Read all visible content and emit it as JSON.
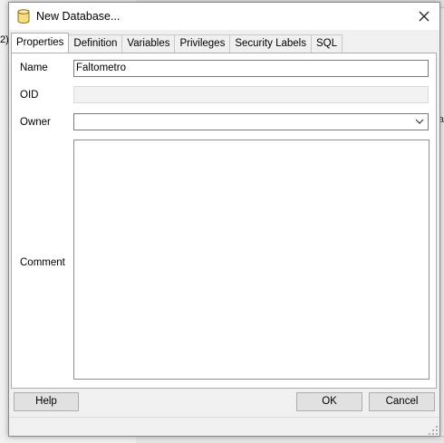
{
  "background": {
    "left_text": "2)",
    "right_text": "ra"
  },
  "dialog": {
    "title": "New Database...",
    "tabs": [
      {
        "label": "Properties",
        "active": true
      },
      {
        "label": "Definition"
      },
      {
        "label": "Variables"
      },
      {
        "label": "Privileges"
      },
      {
        "label": "Security Labels"
      },
      {
        "label": "SQL"
      }
    ],
    "form": {
      "name_label": "Name",
      "name_value": "Faltometro",
      "oid_label": "OID",
      "oid_value": "",
      "owner_label": "Owner",
      "owner_value": "",
      "comment_label": "Comment",
      "comment_value": ""
    },
    "buttons": {
      "help": "Help",
      "ok": "OK",
      "cancel": "Cancel"
    }
  },
  "icons": {
    "db": "database-icon",
    "close": "close-icon",
    "chevron": "chevron-down-icon"
  }
}
